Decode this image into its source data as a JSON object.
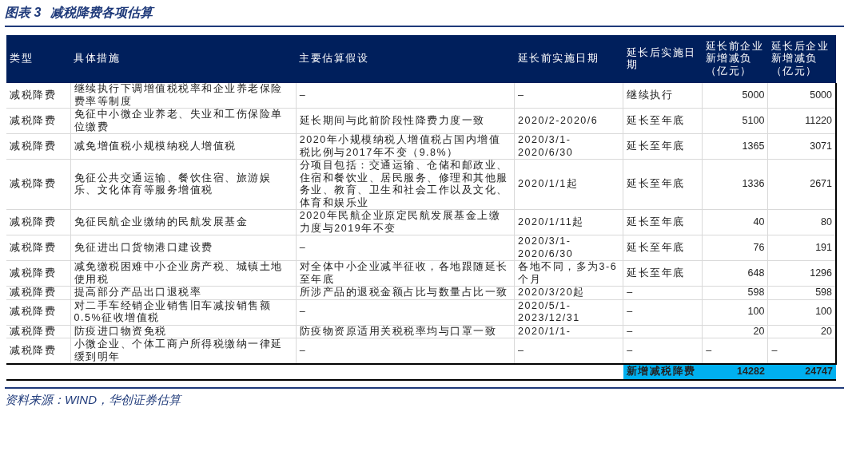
{
  "title": {
    "label": "图表 3",
    "text": "减税降费各项估算"
  },
  "table": {
    "columns": [
      "类型",
      "具体措施",
      "主要估算假设",
      "延长前实施日期",
      "延长后实施日期",
      "延长前企业新增减负（亿元）",
      "延长后企业新增减负（亿元）"
    ],
    "rows": [
      {
        "cells": [
          "减税降费",
          "继续执行下调增值税税率和企业养老保险费率等制度",
          "–",
          "–",
          "继续执行",
          "5000",
          "5000"
        ]
      },
      {
        "cells": [
          "减税降费",
          "免征中小微企业养老、失业和工伤保险单位缴费",
          "延长期间与此前阶段性降费力度一致",
          "2020/2-2020/6",
          "延长至年底",
          "5100",
          "11220"
        ]
      },
      {
        "cells": [
          "减税降费",
          "减免增值税小规模纳税人增值税",
          "2020年小规模纳税人增值税占国内增值税比例与2017年不变（9.8%）",
          "2020/3/1-2020/6/30",
          "延长至年底",
          "1365",
          "3071"
        ]
      },
      {
        "cells": [
          "减税降费",
          "免征公共交通运输、餐饮住宿、旅游娱乐、文化体育等服务增值税",
          "分项目包括：交通运输、仓储和邮政业、住宿和餐饮业、居民服务、修理和其他服务业、教育、卫生和社会工作以及文化、体育和娱乐业",
          "2020/1/1起",
          "延长至年底",
          "1336",
          "2671"
        ]
      },
      {
        "cells": [
          "减税降费",
          "免征民航企业缴纳的民航发展基金",
          "2020年民航企业原定民航发展基金上缴力度与2019年不变",
          "2020/1/11起",
          "延长至年底",
          "40",
          "80"
        ]
      },
      {
        "cells": [
          "减税降费",
          "免征进出口货物港口建设费",
          "–",
          "2020/3/1-2020/6/30",
          "延长至年底",
          "76",
          "191"
        ]
      },
      {
        "cells": [
          "减税降费",
          "减免缴税困难中小企业房产税、城镇土地使用税",
          "对全体中小企业减半征收，各地跟随延长至年底",
          "各地不同，多为3-6个月",
          "延长至年底",
          "648",
          "1296"
        ]
      },
      {
        "cells": [
          "减税降费",
          "提高部分产品出口退税率",
          "所涉产品的退税金额占比与数量占比一致",
          "2020/3/20起",
          "–",
          "598",
          "598"
        ]
      },
      {
        "cells": [
          "减税降费",
          "对二手车经销企业销售旧车减按销售额0.5%征收增值税",
          "–",
          "2020/5/1-2023/12/31",
          "–",
          "100",
          "100"
        ]
      },
      {
        "cells": [
          "减税降费",
          "防疫进口物资免税",
          "防疫物资原适用关税税率均与口罩一致",
          "2020/1/1-",
          "–",
          "20",
          "20"
        ]
      },
      {
        "cells": [
          "减税降费",
          "小微企业、个体工商户所得税缴纳一律延缓到明年",
          "–",
          "–",
          "–",
          "–",
          "–"
        ]
      }
    ],
    "total": {
      "label": "新增减税降费",
      "values": [
        "14282",
        "24747"
      ]
    }
  },
  "source": "资料来源：WIND，华创证券估算"
}
